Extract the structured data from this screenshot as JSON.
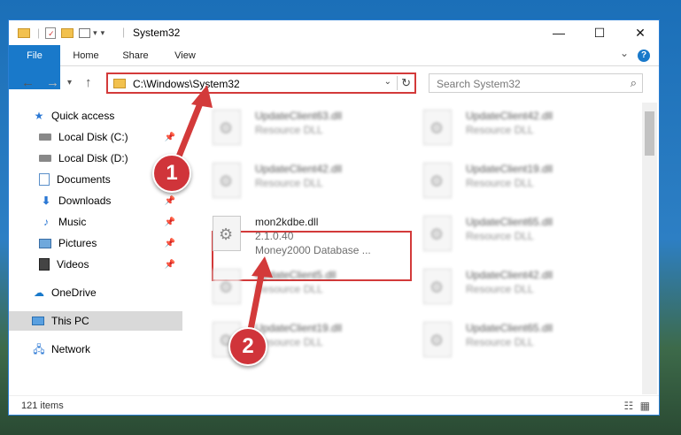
{
  "window": {
    "title": "System32",
    "controls": {
      "minimize": "—",
      "maximize": "☐",
      "close": "✕"
    }
  },
  "ribbon": {
    "tabs": [
      "File",
      "Home",
      "Share",
      "View"
    ],
    "expand": "⌄",
    "help": "?"
  },
  "address": {
    "path": "C:\\Windows\\System32",
    "search_placeholder": "Search System32"
  },
  "sidebar": {
    "items": [
      {
        "label": "Quick access",
        "icon": "star-icon"
      },
      {
        "label": "Local Disk (C:)",
        "icon": "drive-icon"
      },
      {
        "label": "Local Disk (D:)",
        "icon": "drive-icon"
      },
      {
        "label": "Documents",
        "icon": "documents-icon"
      },
      {
        "label": "Downloads",
        "icon": "downloads-icon"
      },
      {
        "label": "Music",
        "icon": "music-icon"
      },
      {
        "label": "Pictures",
        "icon": "pictures-icon"
      },
      {
        "label": "Videos",
        "icon": "videos-icon"
      },
      {
        "label": "OneDrive",
        "icon": "cloud-icon"
      },
      {
        "label": "This PC",
        "icon": "computer-icon"
      },
      {
        "label": "Network",
        "icon": "network-icon"
      }
    ]
  },
  "files": [
    {
      "name": "UpdateClient63.dll",
      "desc": "Resource DLL"
    },
    {
      "name": "UpdateClient42.dll",
      "desc": "Resource DLL"
    },
    {
      "name": "UpdateClient42.dll",
      "desc": "Resource DLL"
    },
    {
      "name": "UpdateClient19.dll",
      "desc": "Resource DLL"
    },
    {
      "name": "mon2kdbe.dll",
      "desc": "2.1.0.40",
      "desc2": "Money2000 Database ..."
    },
    {
      "name": "UpdateClient65.dll",
      "desc": "Resource DLL"
    },
    {
      "name": "UpdateClient5.dll",
      "desc": "Resource DLL"
    },
    {
      "name": "UpdateClient42.dll",
      "desc": "Resource DLL"
    },
    {
      "name": "UpdateClient19.dll",
      "desc": "Resource DLL"
    },
    {
      "name": "UpdateClient65.dll",
      "desc": "Resource DLL"
    }
  ],
  "status": {
    "count": "121 items"
  },
  "annotations": {
    "step1": "1",
    "step2": "2"
  },
  "colors": {
    "accent": "#1979ca",
    "highlight": "#d33a3a"
  }
}
